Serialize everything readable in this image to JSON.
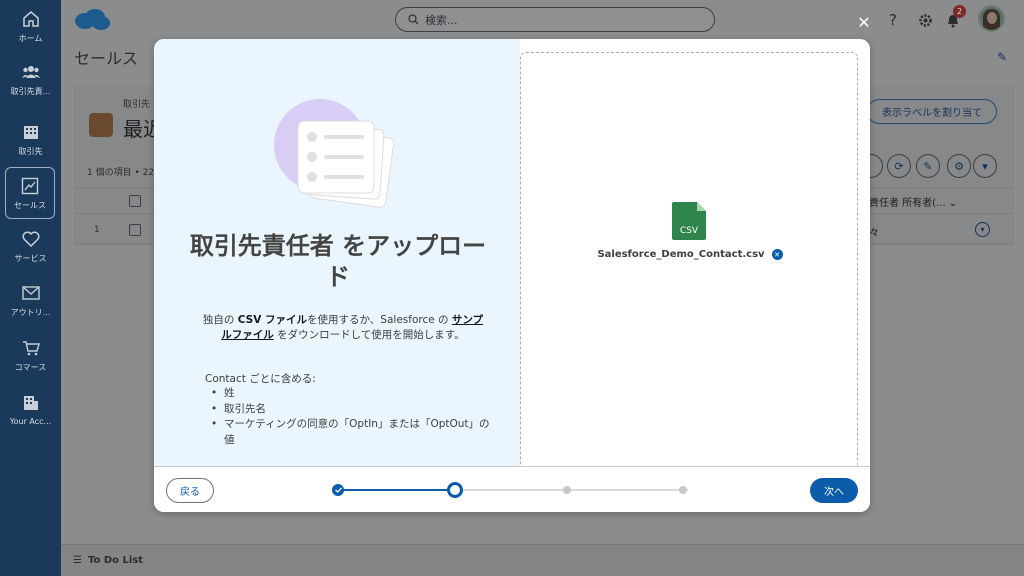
{
  "left_nav": {
    "items": [
      {
        "label": "ホーム",
        "icon": "home-icon"
      },
      {
        "label": "取引先責...",
        "icon": "contacts-icon"
      },
      {
        "label": "取引先",
        "icon": "building-icon"
      },
      {
        "label": "セールス",
        "icon": "sales-chart-icon",
        "active": true
      },
      {
        "label": "サービス",
        "icon": "heart-icon"
      },
      {
        "label": "アウトリ...",
        "icon": "mail-icon"
      },
      {
        "label": "コマース",
        "icon": "cart-icon"
      },
      {
        "label": "Your Acc...",
        "icon": "account-building-icon"
      }
    ]
  },
  "topbar": {
    "search_placeholder": "検索...",
    "notification_count": "2"
  },
  "app": {
    "title": "セールス",
    "object_sub": "取引先",
    "object_title": "最近",
    "assign_button": "表示ラベルを割り当て",
    "count_text": "1 個の項目 • 22",
    "column_header_right": "責任者 所有者(...",
    "row_number": "1",
    "row_cell_right": "々",
    "footer_label": "To Do List"
  },
  "modal": {
    "title": "取引先責任者 をアップロード",
    "description_prefix": "独自の ",
    "description_csv": "CSV ファイル",
    "description_mid": "を使用するか、Salesforce の ",
    "description_link": "サンプルファイル",
    "description_suffix": " をダウンロードして使用を開始します。",
    "contact_heading": "Contact ごとに含める:",
    "requirements": [
      "姓",
      "取引先名",
      "マーケティングの同意の「OptIn」または「OptOut」の値"
    ],
    "file": {
      "icon_label": "CSV",
      "name": "Salesforce_Demo_Contact.csv"
    },
    "back_button": "戻る",
    "next_button": "次へ",
    "progress": {
      "total_steps": 4,
      "completed_steps": 1,
      "current_step": 2
    }
  },
  "colors": {
    "brand_blue": "#0b5cab",
    "modal_left_bg": "#eaf5fe",
    "csv_green": "#2e844a",
    "illustration_purple": "#d9ccf5"
  }
}
